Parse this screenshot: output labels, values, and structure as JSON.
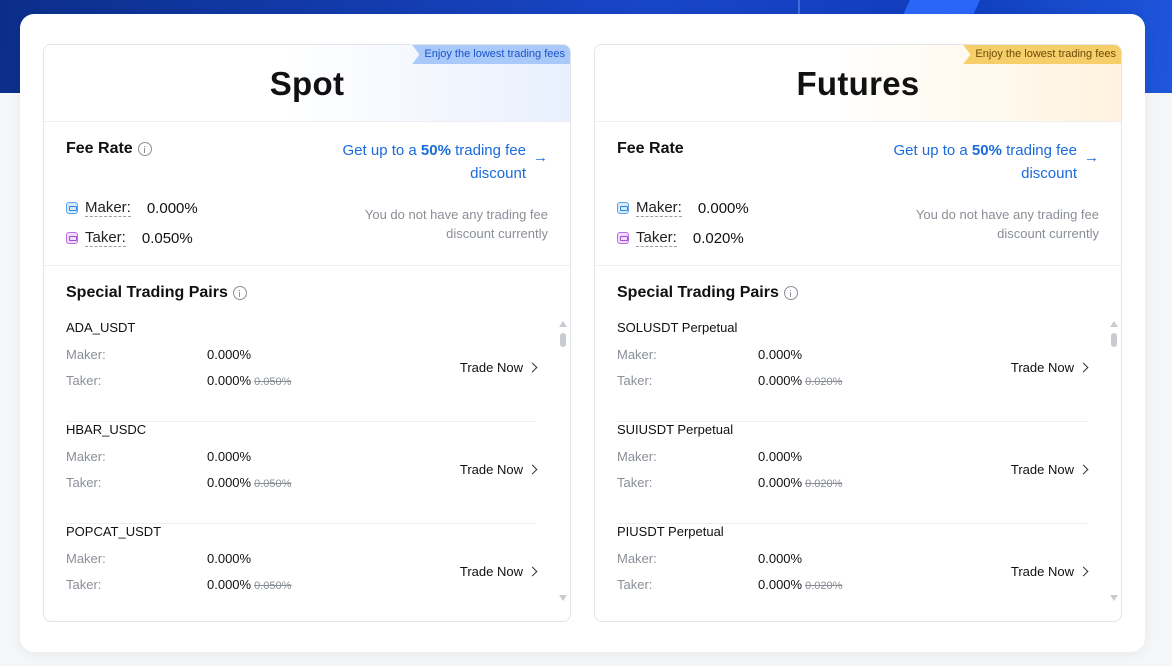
{
  "spot": {
    "title": "Spot",
    "ribbon": "Enjoy the lowest trading fees",
    "fee_rate_label": "Fee Rate",
    "discount_prefix": "Get up to a ",
    "discount_pct": "50%",
    "discount_suffix": " trading fee discount",
    "maker_label": "Maker:",
    "maker_value": "0.000%",
    "taker_label": "Taker:",
    "taker_value": "0.050%",
    "no_discount": "You do not have any trading fee discount currently",
    "special_pairs_label": "Special Trading Pairs",
    "pairs": [
      {
        "name": "ADA_USDT",
        "maker_label": "Maker:",
        "maker": "0.000%",
        "taker_label": "Taker:",
        "taker": "0.000%",
        "taker_original": "0.050%",
        "action": "Trade Now"
      },
      {
        "name": "HBAR_USDC",
        "maker_label": "Maker:",
        "maker": "0.000%",
        "taker_label": "Taker:",
        "taker": "0.000%",
        "taker_original": "0.050%",
        "action": "Trade Now"
      },
      {
        "name": "POPCAT_USDT",
        "maker_label": "Maker:",
        "maker": "0.000%",
        "taker_label": "Taker:",
        "taker": "0.000%",
        "taker_original": "0.050%",
        "action": "Trade Now"
      }
    ]
  },
  "futures": {
    "title": "Futures",
    "ribbon": "Enjoy the lowest trading fees",
    "fee_rate_label": "Fee Rate",
    "discount_prefix": "Get up to a ",
    "discount_pct": "50%",
    "discount_suffix": " trading fee discount",
    "maker_label": "Maker:",
    "maker_value": "0.000%",
    "taker_label": "Taker:",
    "taker_value": "0.020%",
    "no_discount": "You do not have any trading fee discount currently",
    "special_pairs_label": "Special Trading Pairs",
    "pairs": [
      {
        "name": "SOLUSDT Perpetual",
        "maker_label": "Maker:",
        "maker": "0.000%",
        "taker_label": "Taker:",
        "taker": "0.000%",
        "taker_original": "0.020%",
        "action": "Trade Now"
      },
      {
        "name": "SUIUSDT Perpetual",
        "maker_label": "Maker:",
        "maker": "0.000%",
        "taker_label": "Taker:",
        "taker": "0.000%",
        "taker_original": "0.020%",
        "action": "Trade Now"
      },
      {
        "name": "PIUSDT Perpetual",
        "maker_label": "Maker:",
        "maker": "0.000%",
        "taker_label": "Taker:",
        "taker": "0.000%",
        "taker_original": "0.020%",
        "action": "Trade Now"
      }
    ]
  },
  "colors": {
    "accent_link": "#1a6bdb",
    "spot_ribbon": "#a9c9fb",
    "futures_ribbon": "#f6cf6b",
    "hero_bg": "#1846c8"
  }
}
